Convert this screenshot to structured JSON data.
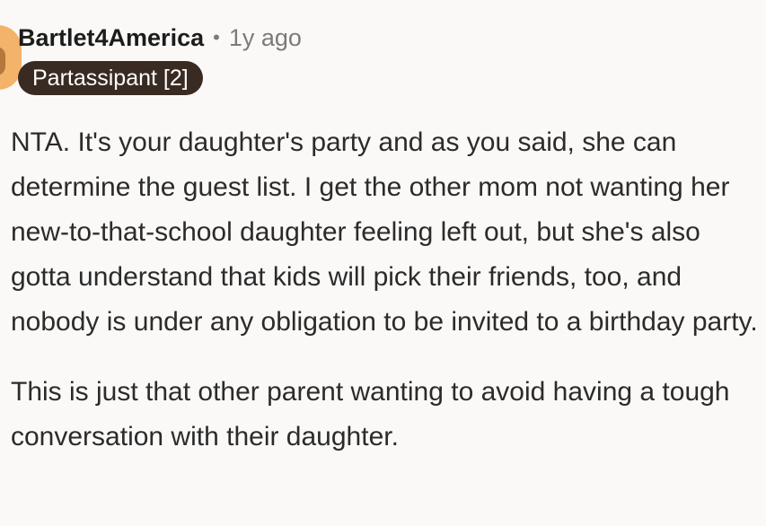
{
  "comment": {
    "username": "Bartlet4America",
    "separator": "•",
    "timestamp": "1y ago",
    "flair": "Partassipant [2]",
    "paragraphs": [
      "NTA. It's your daughter's party and as you said, she can determine the guest list. I get the other mom not wanting her new-to-that-school daughter feeling left out, but she's also gotta understand that kids will pick their friends, too, and nobody is under any obligation to be invited to a birthday party.",
      "This is just that other parent wanting to avoid having a tough conversation with their daughter."
    ]
  },
  "icons": {
    "avatar": "user-avatar-icon"
  },
  "colors": {
    "background": "#fbf9f7",
    "flair_bg": "#3a2b22",
    "avatar": "#f4b36a",
    "muted_text": "#7a7a7a"
  }
}
